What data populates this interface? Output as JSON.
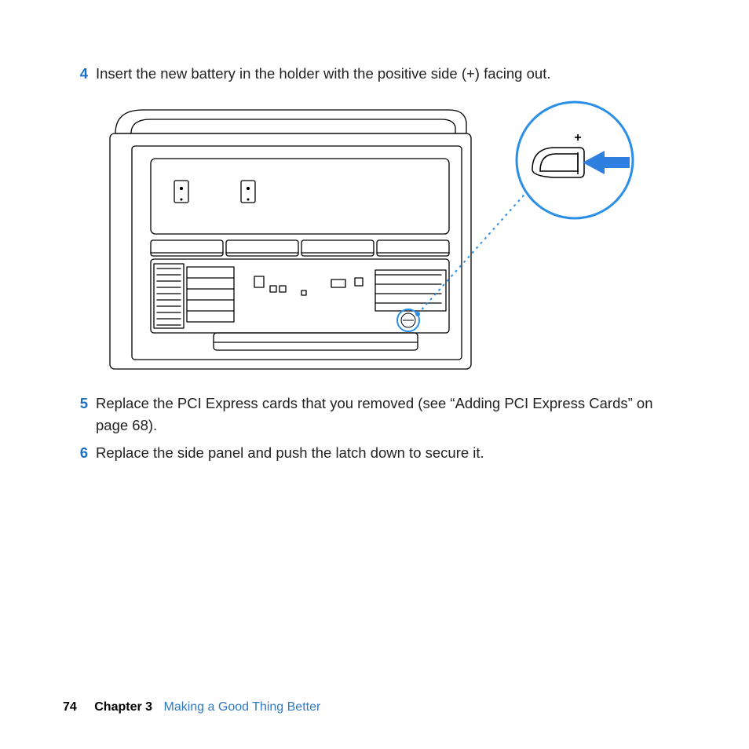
{
  "steps": [
    {
      "num": "4",
      "text": "Insert the new battery in the holder with the positive side (+) facing out."
    },
    {
      "num": "5",
      "text": "Replace the PCI Express cards that you removed (see “Adding PCI Express Cards” on page 68)."
    },
    {
      "num": "6",
      "text": "Replace the side panel and push the latch down to secure it."
    }
  ],
  "figure": {
    "alt": "Line illustration of the interior of a desktop computer enclosure with drive bays and a logic board area. A dotted line leads from a small circular battery holder on the board to an enlarged circular detail at the upper-right showing a coin-cell battery, a plus sign, and a blue arrow indicating insertion direction.",
    "plus_label": "+"
  },
  "footer": {
    "page_number": "74",
    "chapter_label": "Chapter 3",
    "chapter_title": "Making a Good Thing Better"
  },
  "colors": {
    "accent_blue": "#1a6fc4",
    "bright_blue": "#2a8fe6",
    "arrow_blue": "#2f7fe0",
    "link_blue": "#2f78c7"
  }
}
